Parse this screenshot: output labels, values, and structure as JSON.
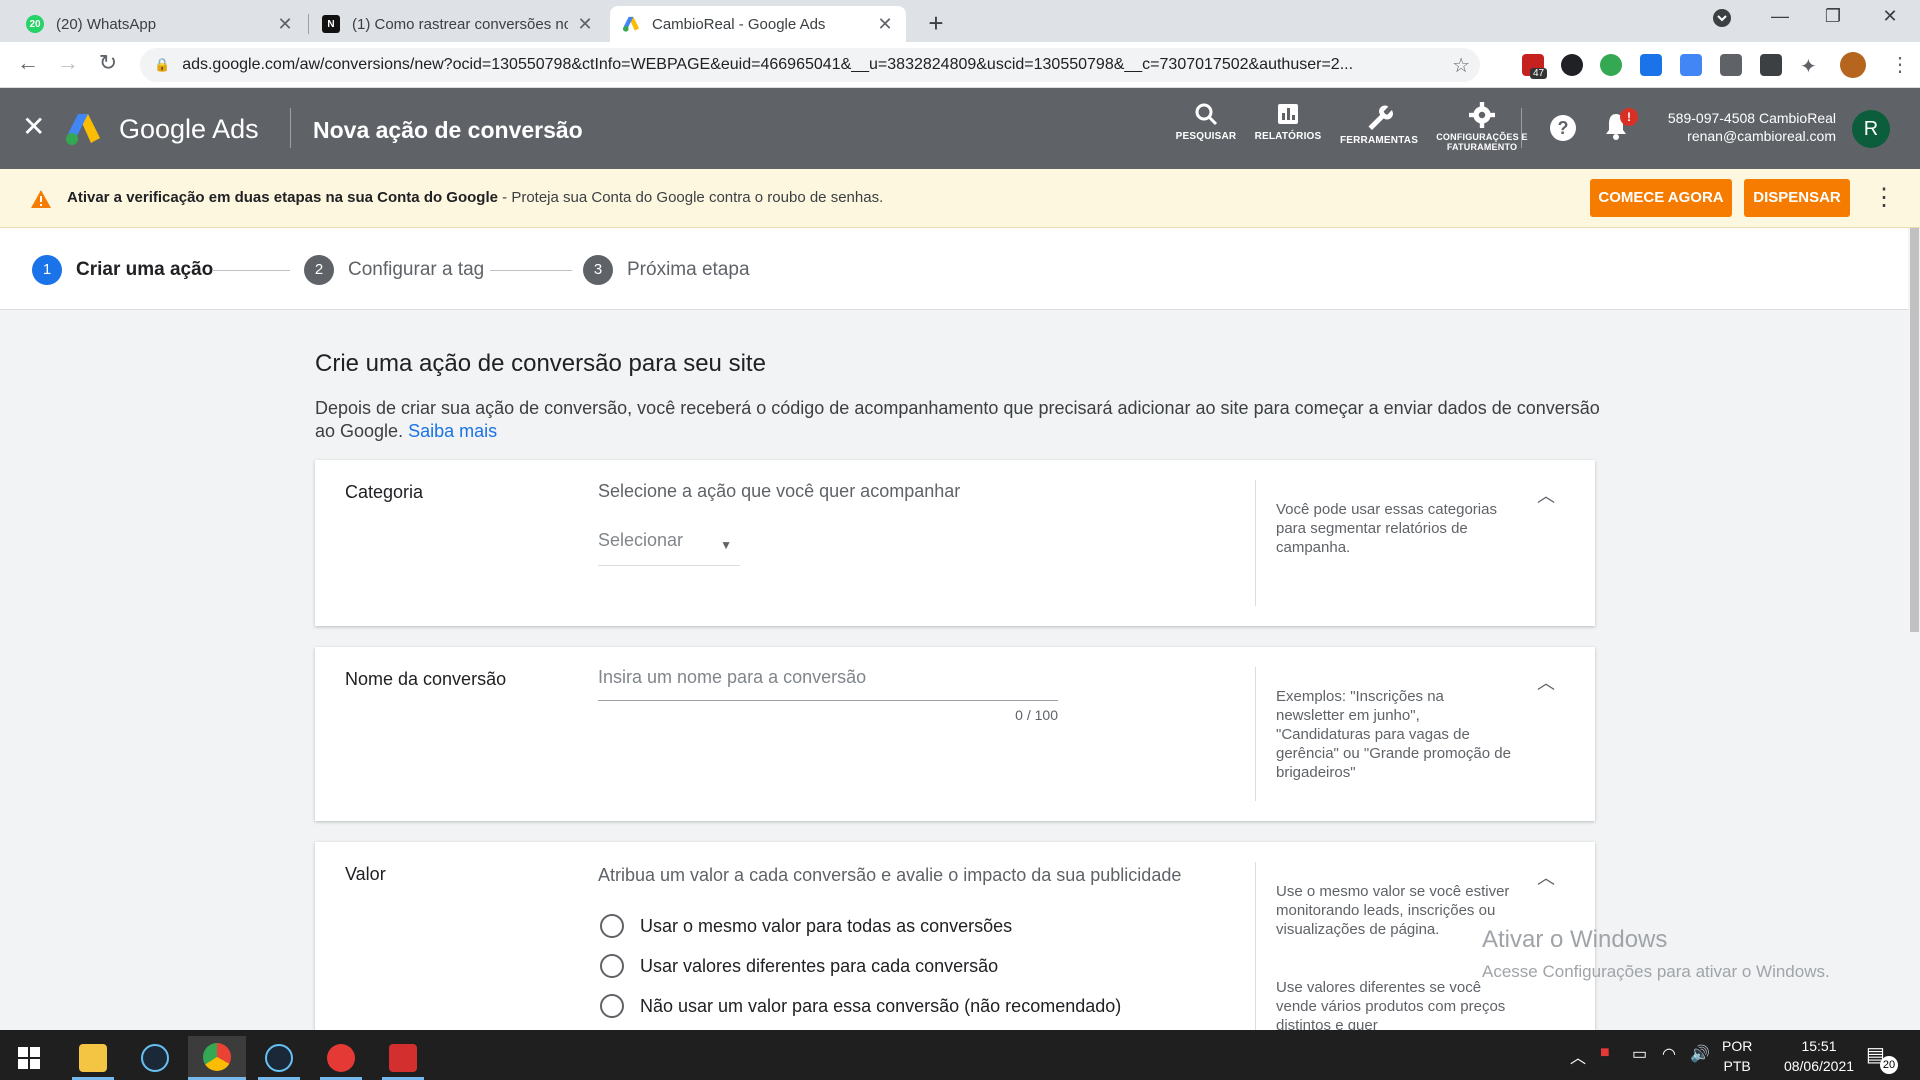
{
  "browser": {
    "tabs": [
      {
        "title": "(20) WhatsApp",
        "favicon_text": "20",
        "favicon_color": "#25d366"
      },
      {
        "title": "(1) Como rastrear conversões no",
        "favicon_text": "N",
        "favicon_color": "#111111"
      },
      {
        "title": "CambioReal - Google Ads",
        "favicon_text": "",
        "favicon_color": "#fbbc04"
      }
    ],
    "url": "ads.google.com/aw/conversions/new?ocid=130550798&ctInfo=WEBPAGE&euid=466965041&__u=3832824809&uscid=130550798&__c=7307017502&authuser=2...",
    "extension_badge": "47"
  },
  "ads_header": {
    "brand": "Google Ads",
    "page_title": "Nova ação de conversão",
    "tools": [
      {
        "label": "PESQUISAR",
        "icon": "search-icon"
      },
      {
        "label": "RELATÓRIOS",
        "icon": "reports-icon"
      },
      {
        "label": "FERRAMENTAS",
        "icon": "wrench-icon"
      },
      {
        "label": "CONFIGURAÇÕES E FATURAMENTO",
        "icon": "gear-icon"
      }
    ],
    "notification_badge": "!",
    "account_id": "589-097-4508 CambioReal",
    "account_email": "renan@cambioreal.com",
    "avatar_letter": "R"
  },
  "banner": {
    "bold_text": "Ativar a verificação em duas etapas na sua Conta do Google",
    "text": " - Proteja sua Conta do Google contra o roubo de senhas.",
    "primary_button": "COMECE AGORA",
    "secondary_button": "DISPENSAR"
  },
  "stepper": {
    "steps": [
      {
        "number": "1",
        "label": "Criar uma ação",
        "active": true
      },
      {
        "number": "2",
        "label": "Configurar a tag",
        "active": false
      },
      {
        "number": "3",
        "label": "Próxima etapa",
        "active": false
      }
    ]
  },
  "main": {
    "heading": "Crie uma ação de conversão para seu site",
    "description": "Depois de criar sua ação de conversão, você receberá o código de acompanhamento que precisará adicionar ao site para começar a enviar dados de conversão ao Google.",
    "learn_more": "Saiba mais",
    "category_card": {
      "title": "Categoria",
      "hint": "Selecione a ação que você quer acompanhar",
      "select_placeholder": "Selecionar",
      "side_text": "Você pode usar essas categorias para segmentar relatórios de campanha."
    },
    "name_card": {
      "title": "Nome da conversão",
      "placeholder": "Insira um nome para a conversão",
      "counter": "0 / 100",
      "side_text": "Exemplos: \"Inscrições na newsletter em junho\", \"Candidaturas para vagas de gerência\" ou \"Grande promoção de brigadeiros\""
    },
    "value_card": {
      "title": "Valor",
      "hint": "Atribua um valor a cada conversão e avalie o impacto da sua publicidade",
      "options": [
        "Usar o mesmo valor para todas as conversões",
        "Usar valores diferentes para cada conversão",
        "Não usar um valor para essa conversão (não recomendado)"
      ],
      "side_text_1": "Use o mesmo valor se você estiver monitorando leads, inscrições ou visualizações de página.",
      "side_text_2": "Use valores diferentes se você vende vários produtos com preços distintos e quer"
    }
  },
  "watermark": {
    "line1": "Ativar o Windows",
    "line2": "Acesse Configurações para ativar o Windows."
  },
  "taskbar": {
    "language_1": "POR",
    "language_2": "PTB",
    "time": "15:51",
    "date": "08/06/2021",
    "notification_count": "20"
  },
  "colors": {
    "ads_header_bg": "#5f6368",
    "banner_bg": "#fef7e0",
    "accent_orange": "#f57c00",
    "step_active": "#1a73e8",
    "step_inactive": "#5f6368",
    "link": "#1a73e8"
  }
}
